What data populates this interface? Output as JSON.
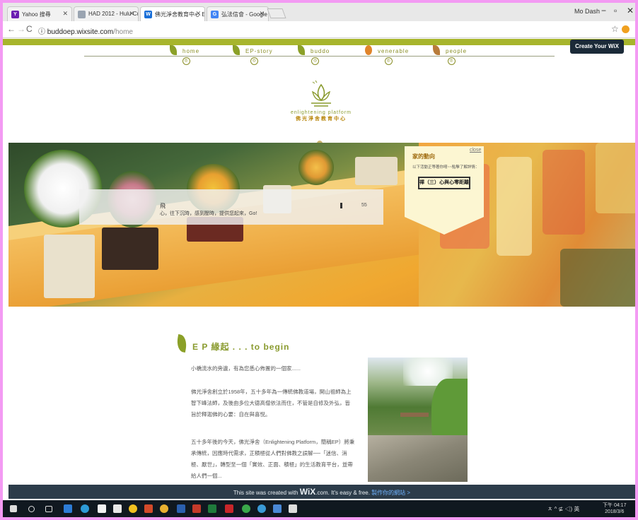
{
  "browser": {
    "tabs": [
      {
        "label": "Yahoo 搜尋",
        "icon": "yahoo-icon",
        "color": "#6b1fb1",
        "glyph": "Y"
      },
      {
        "label": "HAD 2012 - Hulu Cultu",
        "icon": "document-icon",
        "color": "#9aa4b1",
        "glyph": ""
      },
      {
        "label": "佛光淨舍教育中心 E",
        "icon": "wix-icon",
        "color": "#1a6fd8",
        "glyph": "W"
      },
      {
        "label": "弘法信會 - Google 搜尋",
        "icon": "google-icon",
        "color": "#4285f4",
        "glyph": "G"
      }
    ],
    "user": "Mo Dash",
    "url_host": "buddoep.wixsite.com",
    "url_path": "/home"
  },
  "wix_create_label": "Create Your WiX Site",
  "nav": {
    "items": [
      {
        "label": "home",
        "icon": "leaf-icon"
      },
      {
        "label": "EP-story",
        "icon": "leaf-icon"
      },
      {
        "label": "buddo",
        "icon": "leaf-icon"
      },
      {
        "label": "venerable",
        "icon": "flower-icon"
      },
      {
        "label": "people",
        "icon": "leaf-icon"
      }
    ]
  },
  "logo": {
    "en": "enlightening platform",
    "zh": "佛光淨舍教育中心"
  },
  "hero": {
    "strip_title": "飛",
    "strip_text": "心，往下沉時，感到壓時，提供您起來，Go!",
    "strip_num": "55"
  },
  "notice": {
    "close": "close",
    "title": "家的動向",
    "desc": "以下活動正等著你唷~~點擊了解詳情：",
    "button": "禪（三）心與心零距離"
  },
  "section": {
    "title": "E P 緣起 . . . to begin",
    "paragraphs": [
      "小橋流水的旁邊，有為您悉心佈置的一個家......",
      "佛光淨舍創立於1958年，五十多年為一傳統佛教道場，開山祖師為上智下峰法師，及後由多位大德高僧依法而住，不管是自修及外弘，皆旨於釋迦佛的心要：自在與喜悅。",
      "五十多年後的今天，佛光淨舍（Enlightening Platform，簡稱EP）將秉承傳統，因應時代需求，正積極從人們對佛教之誤解──「迷信、消極、厭世」，轉型至一個「實效、正面、積極」的生活教育平台，並帶給人們一個..."
    ]
  },
  "wix_banner": {
    "pre": "This site was created with ",
    "brand": "WiX",
    "post": ".com. It's easy & free. ",
    "link": "製作你的網站 >"
  },
  "taskbar": {
    "tray": "ㅊ ^ ⊈ ◁) 英",
    "time": "下午 04:17",
    "date": "2018/3/6"
  }
}
